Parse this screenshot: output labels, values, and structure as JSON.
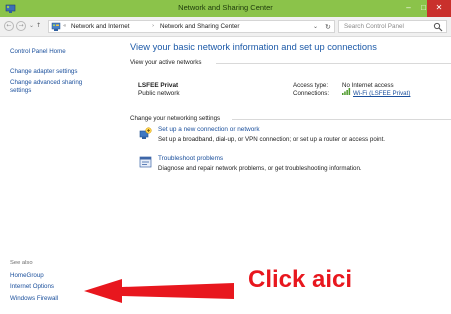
{
  "window": {
    "title": "Network and Sharing Center",
    "minimize_glyph": "–",
    "maximize_glyph": "□",
    "close_glyph": "✕"
  },
  "address_bar": {
    "back_glyph": "←",
    "forward_glyph": "→",
    "recent_glyph": "⌄",
    "up_glyph": "↑",
    "overflow_glyph": "«",
    "crumbs": [
      "Network and Internet",
      "Network and Sharing Center"
    ],
    "crumb_separator": "›",
    "dropdown_glyph": "⌄",
    "refresh_glyph": "↻",
    "search_placeholder": "Search Control Panel"
  },
  "sidebar": {
    "links": [
      "Control Panel Home",
      "Change adapter settings",
      "Change advanced sharing\nsettings"
    ],
    "see_also_label": "See also",
    "see_also_links": [
      "HomeGroup",
      "Internet Options",
      "Windows Firewall"
    ]
  },
  "main": {
    "heading": "View your basic network information and set up connections",
    "active_section_title": "View your active networks",
    "network": {
      "name": "LSFEE Privat",
      "type": "Public network",
      "access_type_label": "Access type:",
      "access_type_value": "No Internet access",
      "connections_label": "Connections:",
      "connections_value": "Wi-Fi (LSFEE Privat)"
    },
    "change_section_title": "Change your networking settings",
    "tasks": [
      {
        "link": "Set up a new connection or network",
        "desc": "Set up a broadband, dial-up, or VPN connection; or set up a router or access point.",
        "icon": "new-connection-icon"
      },
      {
        "link": "Troubleshoot problems",
        "desc": "Diagnose and repair network problems, or get troubleshooting information.",
        "icon": "troubleshoot-icon"
      }
    ]
  },
  "annotation": {
    "text": "Click aici",
    "color": "#e8171e"
  },
  "colors": {
    "titlebar": "#8bc34a",
    "link": "#1a4f9c",
    "heading": "#1d5aa8",
    "close_button": "#c9302c"
  }
}
